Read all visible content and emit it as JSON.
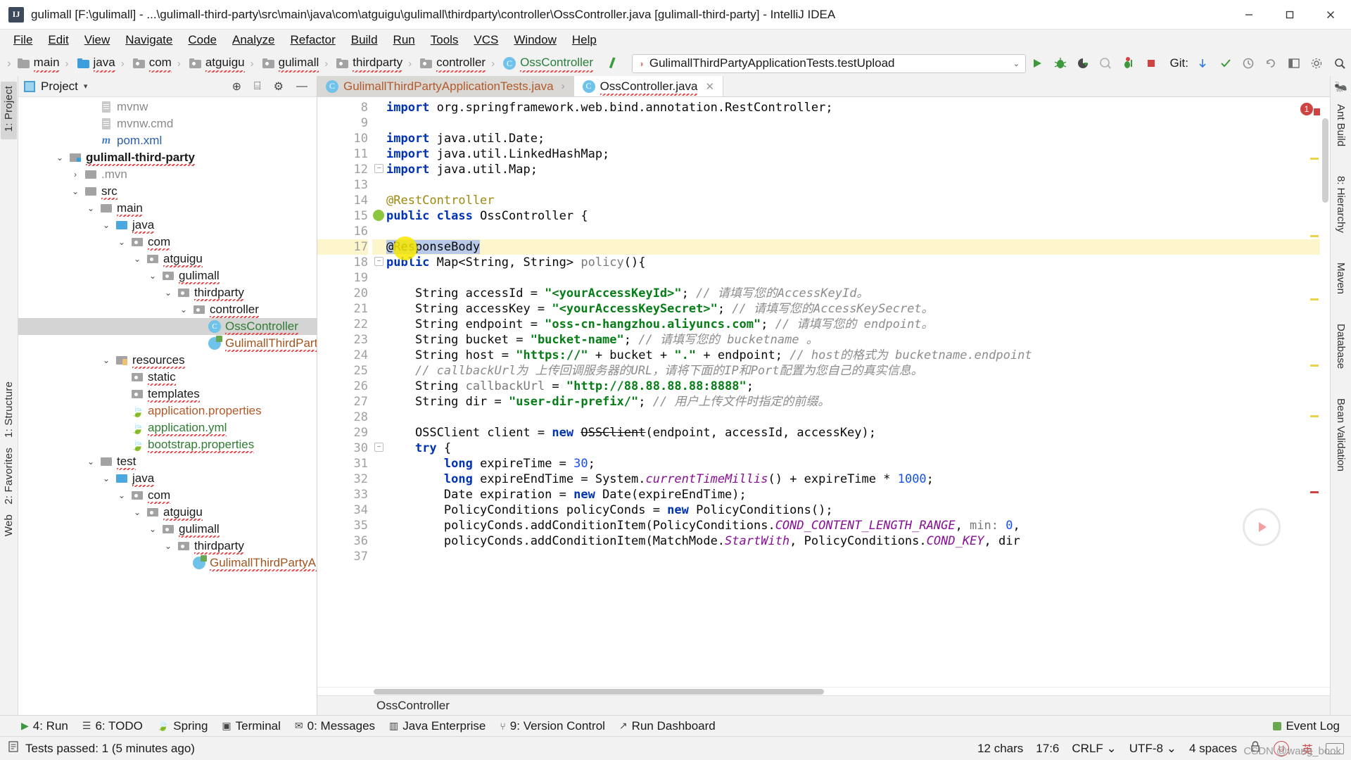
{
  "window": {
    "title": "gulimall [F:\\gulimall] - ...\\gulimall-third-party\\src\\main\\java\\com\\atguigu\\gulimall\\thirdparty\\controller\\OssController.java [gulimall-third-party] - IntelliJ IDEA",
    "app_badge": "IJ",
    "minimize": "–",
    "maximize": "▢",
    "close": "✕"
  },
  "menu": [
    {
      "label": "File"
    },
    {
      "label": "Edit"
    },
    {
      "label": "View"
    },
    {
      "label": "Navigate"
    },
    {
      "label": "Code"
    },
    {
      "label": "Analyze"
    },
    {
      "label": "Refactor"
    },
    {
      "label": "Build"
    },
    {
      "label": "Run"
    },
    {
      "label": "Tools"
    },
    {
      "label": "VCS"
    },
    {
      "label": "Window"
    },
    {
      "label": "Help"
    }
  ],
  "breadcrumb": [
    {
      "label": "main",
      "type": "folder"
    },
    {
      "label": "java",
      "type": "folder-blue"
    },
    {
      "label": "com",
      "type": "package"
    },
    {
      "label": "atguigu",
      "type": "package"
    },
    {
      "label": "gulimall",
      "type": "package"
    },
    {
      "label": "thirdparty",
      "type": "package"
    },
    {
      "label": "controller",
      "type": "package"
    },
    {
      "label": "OssController",
      "type": "class"
    }
  ],
  "run_config": {
    "value": "GulimallThirdPartyApplicationTests.testUpload",
    "caret": "⌄"
  },
  "toolbar": {
    "run_icon": "run-icon",
    "debug_icon": "debug-icon",
    "run_coverage_icon": "run-with-coverage-icon",
    "profile_icon": "profiler-icon",
    "attach_icon": "attach-debugger-icon",
    "stop_icon": "stop-icon",
    "git_label": "Git:",
    "update_icon": "update-project-icon",
    "commit_icon": "commit-icon",
    "history_icon": "history-icon",
    "rollback_icon": "rollback-icon",
    "layout_icon": "layout-icon",
    "settings_icon": "settings-icon",
    "search_icon": "search-icon"
  },
  "project_panel": {
    "title": "Project",
    "caret": "▾",
    "locate_icon": "locate-icon",
    "collapse_icon": "collapse-all-icon",
    "gear_icon": "gear-icon",
    "tree": [
      {
        "label": "mvnw",
        "indent": 4,
        "arrow": "",
        "icon": "file",
        "style": "faded"
      },
      {
        "label": "mvnw.cmd",
        "indent": 4,
        "arrow": "",
        "icon": "file",
        "style": "faded"
      },
      {
        "label": "pom.xml",
        "indent": 4,
        "arrow": "",
        "icon": "maven-file",
        "style": "link"
      },
      {
        "label": "gulimall-third-party",
        "indent": 2,
        "arrow": "⌄",
        "icon": "module",
        "style": "bold"
      },
      {
        "label": ".mvn",
        "indent": 3,
        "arrow": "›",
        "icon": "folder",
        "style": "faded"
      },
      {
        "label": "src",
        "indent": 3,
        "arrow": "⌄",
        "icon": "folder",
        "style": "normal"
      },
      {
        "label": "main",
        "indent": 4,
        "arrow": "⌄",
        "icon": "folder",
        "style": "normal"
      },
      {
        "label": "java",
        "indent": 5,
        "arrow": "⌄",
        "icon": "folder-blue",
        "style": "normal"
      },
      {
        "label": "com",
        "indent": 6,
        "arrow": "⌄",
        "icon": "package",
        "style": "normal"
      },
      {
        "label": "atguigu",
        "indent": 7,
        "arrow": "⌄",
        "icon": "package",
        "style": "normal"
      },
      {
        "label": "gulimall",
        "indent": 8,
        "arrow": "⌄",
        "icon": "package",
        "style": "normal"
      },
      {
        "label": "thirdparty",
        "indent": 9,
        "arrow": "⌄",
        "icon": "package",
        "style": "normal"
      },
      {
        "label": "controller",
        "indent": 10,
        "arrow": "⌄",
        "icon": "package",
        "style": "normal"
      },
      {
        "label": "OssController",
        "indent": 11,
        "arrow": "",
        "icon": "class",
        "style": "green",
        "selected": true
      },
      {
        "label": "GulimallThirdPartyApplic",
        "indent": 11,
        "arrow": "",
        "icon": "spring",
        "style": "brown"
      },
      {
        "label": "resources",
        "indent": 5,
        "arrow": "⌄",
        "icon": "resources",
        "style": "normal"
      },
      {
        "label": "static",
        "indent": 6,
        "arrow": "",
        "icon": "package",
        "style": "normal"
      },
      {
        "label": "templates",
        "indent": 6,
        "arrow": "",
        "icon": "package",
        "style": "normal"
      },
      {
        "label": "application.properties",
        "indent": 6,
        "arrow": "",
        "icon": "spring-leaf",
        "style": "orange"
      },
      {
        "label": "application.yml",
        "indent": 6,
        "arrow": "",
        "icon": "spring-leaf",
        "style": "green"
      },
      {
        "label": "bootstrap.properties",
        "indent": 6,
        "arrow": "",
        "icon": "leaf",
        "style": "green"
      },
      {
        "label": "test",
        "indent": 4,
        "arrow": "⌄",
        "icon": "folder",
        "style": "normal"
      },
      {
        "label": "java",
        "indent": 5,
        "arrow": "⌄",
        "icon": "folder-blue",
        "style": "normal"
      },
      {
        "label": "com",
        "indent": 6,
        "arrow": "⌄",
        "icon": "package",
        "style": "normal"
      },
      {
        "label": "atguigu",
        "indent": 7,
        "arrow": "⌄",
        "icon": "package",
        "style": "normal"
      },
      {
        "label": "gulimall",
        "indent": 8,
        "arrow": "⌄",
        "icon": "package",
        "style": "normal"
      },
      {
        "label": "thirdparty",
        "indent": 9,
        "arrow": "⌄",
        "icon": "package",
        "style": "normal"
      },
      {
        "label": "GulimallThirdPartyApplic",
        "indent": 10,
        "arrow": "",
        "icon": "spring",
        "style": "brown"
      }
    ]
  },
  "left_strip": {
    "project_label": "1: Project",
    "structure_label": "1: Structure",
    "favorites_label": "2: Favorites",
    "web_label": "Web"
  },
  "right_strip": {
    "ant_label": "Ant Build",
    "hierarchy_label": "8: Hierarchy",
    "maven_label": "Maven",
    "database_label": "Database",
    "bean_label": "Bean Validation"
  },
  "editor_tabs": [
    {
      "label": "GulimallThirdPartyApplicationTests.java",
      "active": false,
      "icon": "spring-class-icon"
    },
    {
      "label": "OssController.java",
      "active": true,
      "icon": "class-icon"
    }
  ],
  "editor": {
    "breadcrumb_bottom": "OssController",
    "first_line_number": 8,
    "lines": [
      {
        "n": 8,
        "tokens": [
          {
            "t": "kw",
            "v": "import "
          },
          {
            "t": "p",
            "v": "org.springframework.web.bind.annotation."
          },
          {
            "t": "p",
            "v": "RestController;"
          }
        ],
        "clipped": true
      },
      {
        "n": 9,
        "tokens": []
      },
      {
        "n": 10,
        "tokens": [
          {
            "t": "kw",
            "v": "import "
          },
          {
            "t": "p",
            "v": "java.util.Date;"
          }
        ]
      },
      {
        "n": 11,
        "tokens": [
          {
            "t": "kw",
            "v": "import "
          },
          {
            "t": "p",
            "v": "java.util.LinkedHashMap;"
          }
        ]
      },
      {
        "n": 12,
        "tokens": [
          {
            "t": "kw",
            "v": "import "
          },
          {
            "t": "p",
            "v": "java.util.Map;"
          }
        ],
        "fold": true
      },
      {
        "n": 13,
        "tokens": []
      },
      {
        "n": 14,
        "tokens": [
          {
            "t": "ann",
            "v": "@RestController"
          }
        ]
      },
      {
        "n": 15,
        "tokens": [
          {
            "t": "kw",
            "v": "public class "
          },
          {
            "t": "p",
            "v": "OssController {"
          }
        ],
        "gutter_icon": "spring-bean-icon"
      },
      {
        "n": 16,
        "tokens": []
      },
      {
        "n": 17,
        "tokens": [
          {
            "t": "sel",
            "v": "@ResponseBody"
          }
        ],
        "highlight": true
      },
      {
        "n": 18,
        "tokens": [
          {
            "t": "kw",
            "v": "public "
          },
          {
            "t": "p",
            "v": "Map<String, String> "
          },
          {
            "t": "mth",
            "v": "policy"
          },
          {
            "t": "p",
            "v": "(){"
          }
        ],
        "fold": true
      },
      {
        "n": 19,
        "tokens": []
      },
      {
        "n": 20,
        "tokens": [
          {
            "t": "p",
            "v": "    String accessId = "
          },
          {
            "t": "str",
            "v": "\"<yourAccessKeyId>\""
          },
          {
            "t": "p",
            "v": "; "
          },
          {
            "t": "cmt",
            "v": "// 请填写您的"
          },
          {
            "t": "cmti",
            "v": "AccessKeyId"
          },
          {
            "t": "cmt",
            "v": "。"
          }
        ]
      },
      {
        "n": 21,
        "tokens": [
          {
            "t": "p",
            "v": "    String accessKey = "
          },
          {
            "t": "str",
            "v": "\"<yourAccessKeySecret>\""
          },
          {
            "t": "p",
            "v": "; "
          },
          {
            "t": "cmt",
            "v": "// 请填写您的"
          },
          {
            "t": "cmti",
            "v": "AccessKeySecret"
          },
          {
            "t": "cmt",
            "v": "。"
          }
        ]
      },
      {
        "n": 22,
        "tokens": [
          {
            "t": "p",
            "v": "    String endpoint = "
          },
          {
            "t": "str",
            "v": "\"oss-cn-hangzhou.aliyuncs.com\""
          },
          {
            "t": "p",
            "v": "; "
          },
          {
            "t": "cmt",
            "v": "// 请填写您的 "
          },
          {
            "t": "cmti",
            "v": "endpoint"
          },
          {
            "t": "cmt",
            "v": "。"
          }
        ]
      },
      {
        "n": 23,
        "tokens": [
          {
            "t": "p",
            "v": "    String bucket = "
          },
          {
            "t": "str",
            "v": "\"bucket-name\""
          },
          {
            "t": "p",
            "v": "; "
          },
          {
            "t": "cmt",
            "v": "// 请填写您的 "
          },
          {
            "t": "cmti",
            "v": "bucketname"
          },
          {
            "t": "cmt",
            "v": " 。"
          }
        ]
      },
      {
        "n": 24,
        "tokens": [
          {
            "t": "p",
            "v": "    String host = "
          },
          {
            "t": "str",
            "v": "\"https://\""
          },
          {
            "t": "p",
            "v": " + bucket + "
          },
          {
            "t": "str",
            "v": "\".\""
          },
          {
            "t": "p",
            "v": " + endpoint; "
          },
          {
            "t": "cmt",
            "v": "// host的格式为 "
          },
          {
            "t": "cmti",
            "v": "bucketname.endpoint"
          }
        ]
      },
      {
        "n": 25,
        "tokens": [
          {
            "t": "p",
            "v": "    "
          },
          {
            "t": "cmt",
            "v": "// callbackUrl为 上传回调服务器的"
          },
          {
            "t": "cmti",
            "v": "URL"
          },
          {
            "t": "cmt",
            "v": "，请将下面的"
          },
          {
            "t": "cmti",
            "v": "IP"
          },
          {
            "t": "cmt",
            "v": "和"
          },
          {
            "t": "cmti",
            "v": "Port"
          },
          {
            "t": "cmt",
            "v": "配置为您自己的真实信息。"
          }
        ]
      },
      {
        "n": 26,
        "tokens": [
          {
            "t": "p",
            "v": "    String "
          },
          {
            "t": "mth",
            "v": "callbackUrl"
          },
          {
            "t": "p",
            "v": " = "
          },
          {
            "t": "str",
            "v": "\"http://88.88.88.88:8888\""
          },
          {
            "t": "p",
            "v": ";"
          }
        ]
      },
      {
        "n": 27,
        "tokens": [
          {
            "t": "p",
            "v": "    String dir = "
          },
          {
            "t": "str",
            "v": "\"user-dir-prefix/\""
          },
          {
            "t": "p",
            "v": "; "
          },
          {
            "t": "cmt",
            "v": "// 用户上传文件时指定的前缀。"
          }
        ]
      },
      {
        "n": 28,
        "tokens": []
      },
      {
        "n": 29,
        "tokens": [
          {
            "t": "p",
            "v": "    OSSClient client = "
          },
          {
            "t": "kw",
            "v": "new "
          },
          {
            "t": "strike",
            "v": "OSSClient"
          },
          {
            "t": "p",
            "v": "(endpoint, accessId, accessKey);"
          }
        ]
      },
      {
        "n": 30,
        "tokens": [
          {
            "t": "kw",
            "v": "    try "
          },
          {
            "t": "p",
            "v": "{"
          }
        ],
        "fold": true
      },
      {
        "n": 31,
        "tokens": [
          {
            "t": "p",
            "v": "        "
          },
          {
            "t": "kw",
            "v": "long "
          },
          {
            "t": "p",
            "v": "expireTime = "
          },
          {
            "t": "num",
            "v": "30"
          },
          {
            "t": "p",
            "v": ";"
          }
        ]
      },
      {
        "n": 32,
        "tokens": [
          {
            "t": "p",
            "v": "        "
          },
          {
            "t": "kw",
            "v": "long "
          },
          {
            "t": "p",
            "v": "expireEndTime = System."
          },
          {
            "t": "fldi",
            "v": "currentTimeMillis"
          },
          {
            "t": "p",
            "v": "() + expireTime * "
          },
          {
            "t": "num",
            "v": "1000"
          },
          {
            "t": "p",
            "v": ";"
          }
        ]
      },
      {
        "n": 33,
        "tokens": [
          {
            "t": "p",
            "v": "        Date expiration = "
          },
          {
            "t": "kw",
            "v": "new "
          },
          {
            "t": "p",
            "v": "Date(expireEndTime);"
          }
        ]
      },
      {
        "n": 34,
        "tokens": [
          {
            "t": "p",
            "v": "        PolicyConditions policyConds = "
          },
          {
            "t": "kw",
            "v": "new "
          },
          {
            "t": "p",
            "v": "PolicyConditions();"
          }
        ]
      },
      {
        "n": 35,
        "tokens": [
          {
            "t": "p",
            "v": "        policyConds.addConditionItem(PolicyConditions."
          },
          {
            "t": "fldi",
            "v": "COND_CONTENT_LENGTH_RANGE"
          },
          {
            "t": "p",
            "v": ", "
          },
          {
            "t": "mth",
            "v": "min:"
          },
          {
            "t": "p",
            "v": " "
          },
          {
            "t": "num",
            "v": "0"
          },
          {
            "t": "p",
            "v": ","
          }
        ]
      },
      {
        "n": 36,
        "tokens": [
          {
            "t": "p",
            "v": "        policyConds.addConditionItem(MatchMode."
          },
          {
            "t": "fldi",
            "v": "StartWith"
          },
          {
            "t": "p",
            "v": ", PolicyConditions."
          },
          {
            "t": "fldi",
            "v": "COND_KEY"
          },
          {
            "t": "p",
            "v": ", dir"
          }
        ]
      },
      {
        "n": 37,
        "tokens": []
      }
    ],
    "error_count": "1",
    "error_icon": "error-badge"
  },
  "bottom_toolbar": [
    {
      "label": "4: Run",
      "icon": "run-icon"
    },
    {
      "label": "6: TODO",
      "icon": "todo-icon"
    },
    {
      "label": "Spring",
      "icon": "spring-icon"
    },
    {
      "label": "Terminal",
      "icon": "terminal-icon"
    },
    {
      "label": "0: Messages",
      "icon": "messages-icon"
    },
    {
      "label": "Java Enterprise",
      "icon": "java-ee-icon"
    },
    {
      "label": "9: Version Control",
      "icon": "version-control-icon"
    },
    {
      "label": "Run Dashboard",
      "icon": "dashboard-icon"
    }
  ],
  "event_log": {
    "label": "Event Log",
    "icon": "event-log-icon"
  },
  "status_bar": {
    "message": "Tests passed: 1 (5 minutes ago)",
    "message_icon": "checklist-icon",
    "chars": "12 chars",
    "caret_position": "17:6",
    "line_separator": "CRLF",
    "line_separator_caret": "⌄",
    "encoding": "UTF-8",
    "encoding_caret": "⌄",
    "indent": "4 spaces",
    "ime_badge": "U",
    "ime_lang": "英",
    "keyboard_icon": "keyboard-icon",
    "lock_icon": "lock-icon"
  },
  "watermark": {
    "text": "CSDN @wang_book"
  },
  "colors": {
    "accent_blue": "#3d9ede",
    "keyword_blue": "#0033b3",
    "string_green": "#067d17",
    "comment_gray": "#8c8c8c",
    "annotation_yellow": "#9e880d",
    "highlight_yellow": "#fdf6cd",
    "selection_blue": "#b7c8e8",
    "selected_row_gray": "#d4d4d4",
    "run_green": "#3c9a3c"
  }
}
